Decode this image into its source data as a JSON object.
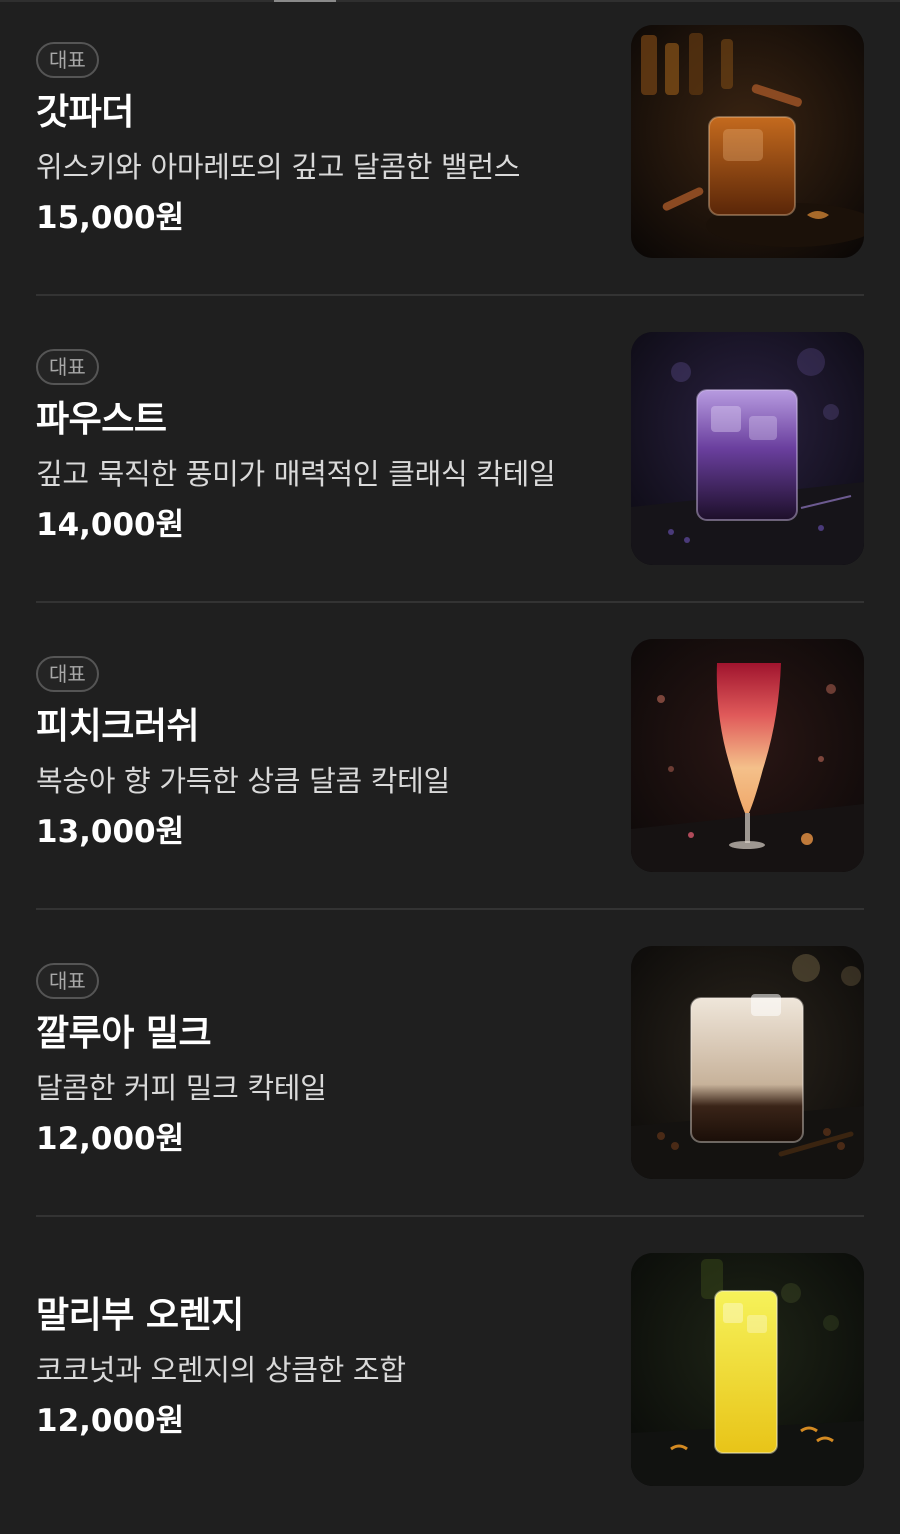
{
  "menu": {
    "items": [
      {
        "badge": "대표",
        "name": "갓파더",
        "description": "위스키와 아마레또의 깊고 달콤한 밸런스",
        "price": "15,000원",
        "image": "whiskey-amaretto-cocktail-photo"
      },
      {
        "badge": "대표",
        "name": "파우스트",
        "description": "깊고 묵직한 풍미가 매력적인 클래식 칵테일",
        "price": "14,000원",
        "image": "purple-layered-cocktail-photo"
      },
      {
        "badge": "대표",
        "name": "피치크러쉬",
        "description": "복숭아 향 가득한 상큼 달콤 칵테일",
        "price": "13,000원",
        "image": "peach-crush-hurricane-glass-photo"
      },
      {
        "badge": "대표",
        "name": "깔루아 밀크",
        "description": "달콤한 커피 밀크 칵테일",
        "price": "12,000원",
        "image": "kahlua-milk-cocktail-photo"
      },
      {
        "name": "말리부 오렌지",
        "description": "코코넛과 오렌지의 상큼한 조합",
        "price": "12,000원",
        "image": "malibu-orange-highball-photo"
      }
    ]
  }
}
